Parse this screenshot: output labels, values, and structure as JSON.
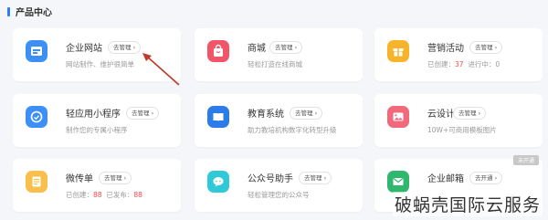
{
  "section": {
    "title": "产品中心"
  },
  "cards": [
    {
      "title": "企业网站",
      "button": "去管理 ›",
      "desc": "网站制作、维护很简单"
    },
    {
      "title": "商城",
      "button": "去管理 ›",
      "desc": "轻松打造在线商城"
    },
    {
      "title": "营销活动",
      "button": "去管理 ›",
      "desc_label1": "已创建：",
      "desc_value1": "37",
      "desc_label2": "进行中：",
      "desc_value2": "0"
    },
    {
      "title": "轻应用小程序",
      "button": "去管理 ›",
      "desc": "制作您的专属小程序"
    },
    {
      "title": "教育系统",
      "button": "去管理 ›",
      "desc": "助力教培机构数字化转型升级"
    },
    {
      "title": "云设计",
      "button": "去管理 ›",
      "desc": "10W+可商用模板图片"
    },
    {
      "title": "微传单",
      "button": "去管理 ›",
      "desc_label1": "已创建：",
      "desc_value1": "88",
      "desc_label2": "已发布：",
      "desc_value2": "88"
    },
    {
      "title": "公众号助手",
      "button": "去管理 ›",
      "desc": "轻松管理您的公众号"
    },
    {
      "title": "企业邮箱",
      "button": "去开通 ›",
      "badge": "未开通"
    }
  ],
  "watermark": "破蜗壳国际云服务",
  "colors": {
    "accent": "#2f7cf6",
    "highlight": "#f04a4a",
    "annotation_arrow": "#c0392b"
  }
}
